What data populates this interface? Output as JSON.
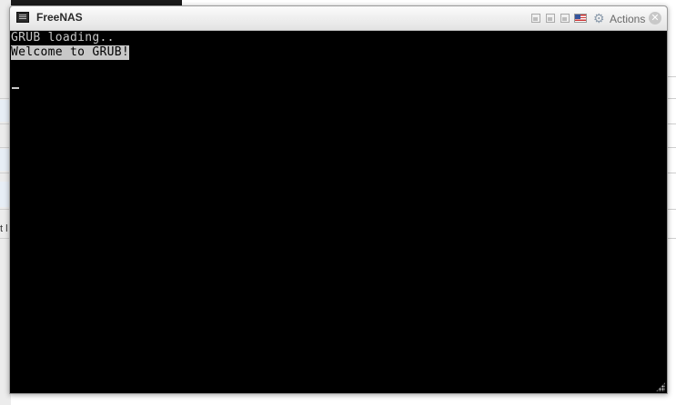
{
  "window": {
    "title": "FreeNAS",
    "actions_label": "Actions",
    "icons": [
      "console-icon",
      "minimize-icon",
      "restore-icon",
      "maximize-icon",
      "flag-icon",
      "gear-icon",
      "close-icon"
    ]
  },
  "console": {
    "lines": [
      "GRUB loading..",
      "Welcome to GRUB!"
    ],
    "background": "#000000",
    "foreground": "#c8c8c8"
  },
  "background_page": {
    "partial_text": "t l"
  }
}
